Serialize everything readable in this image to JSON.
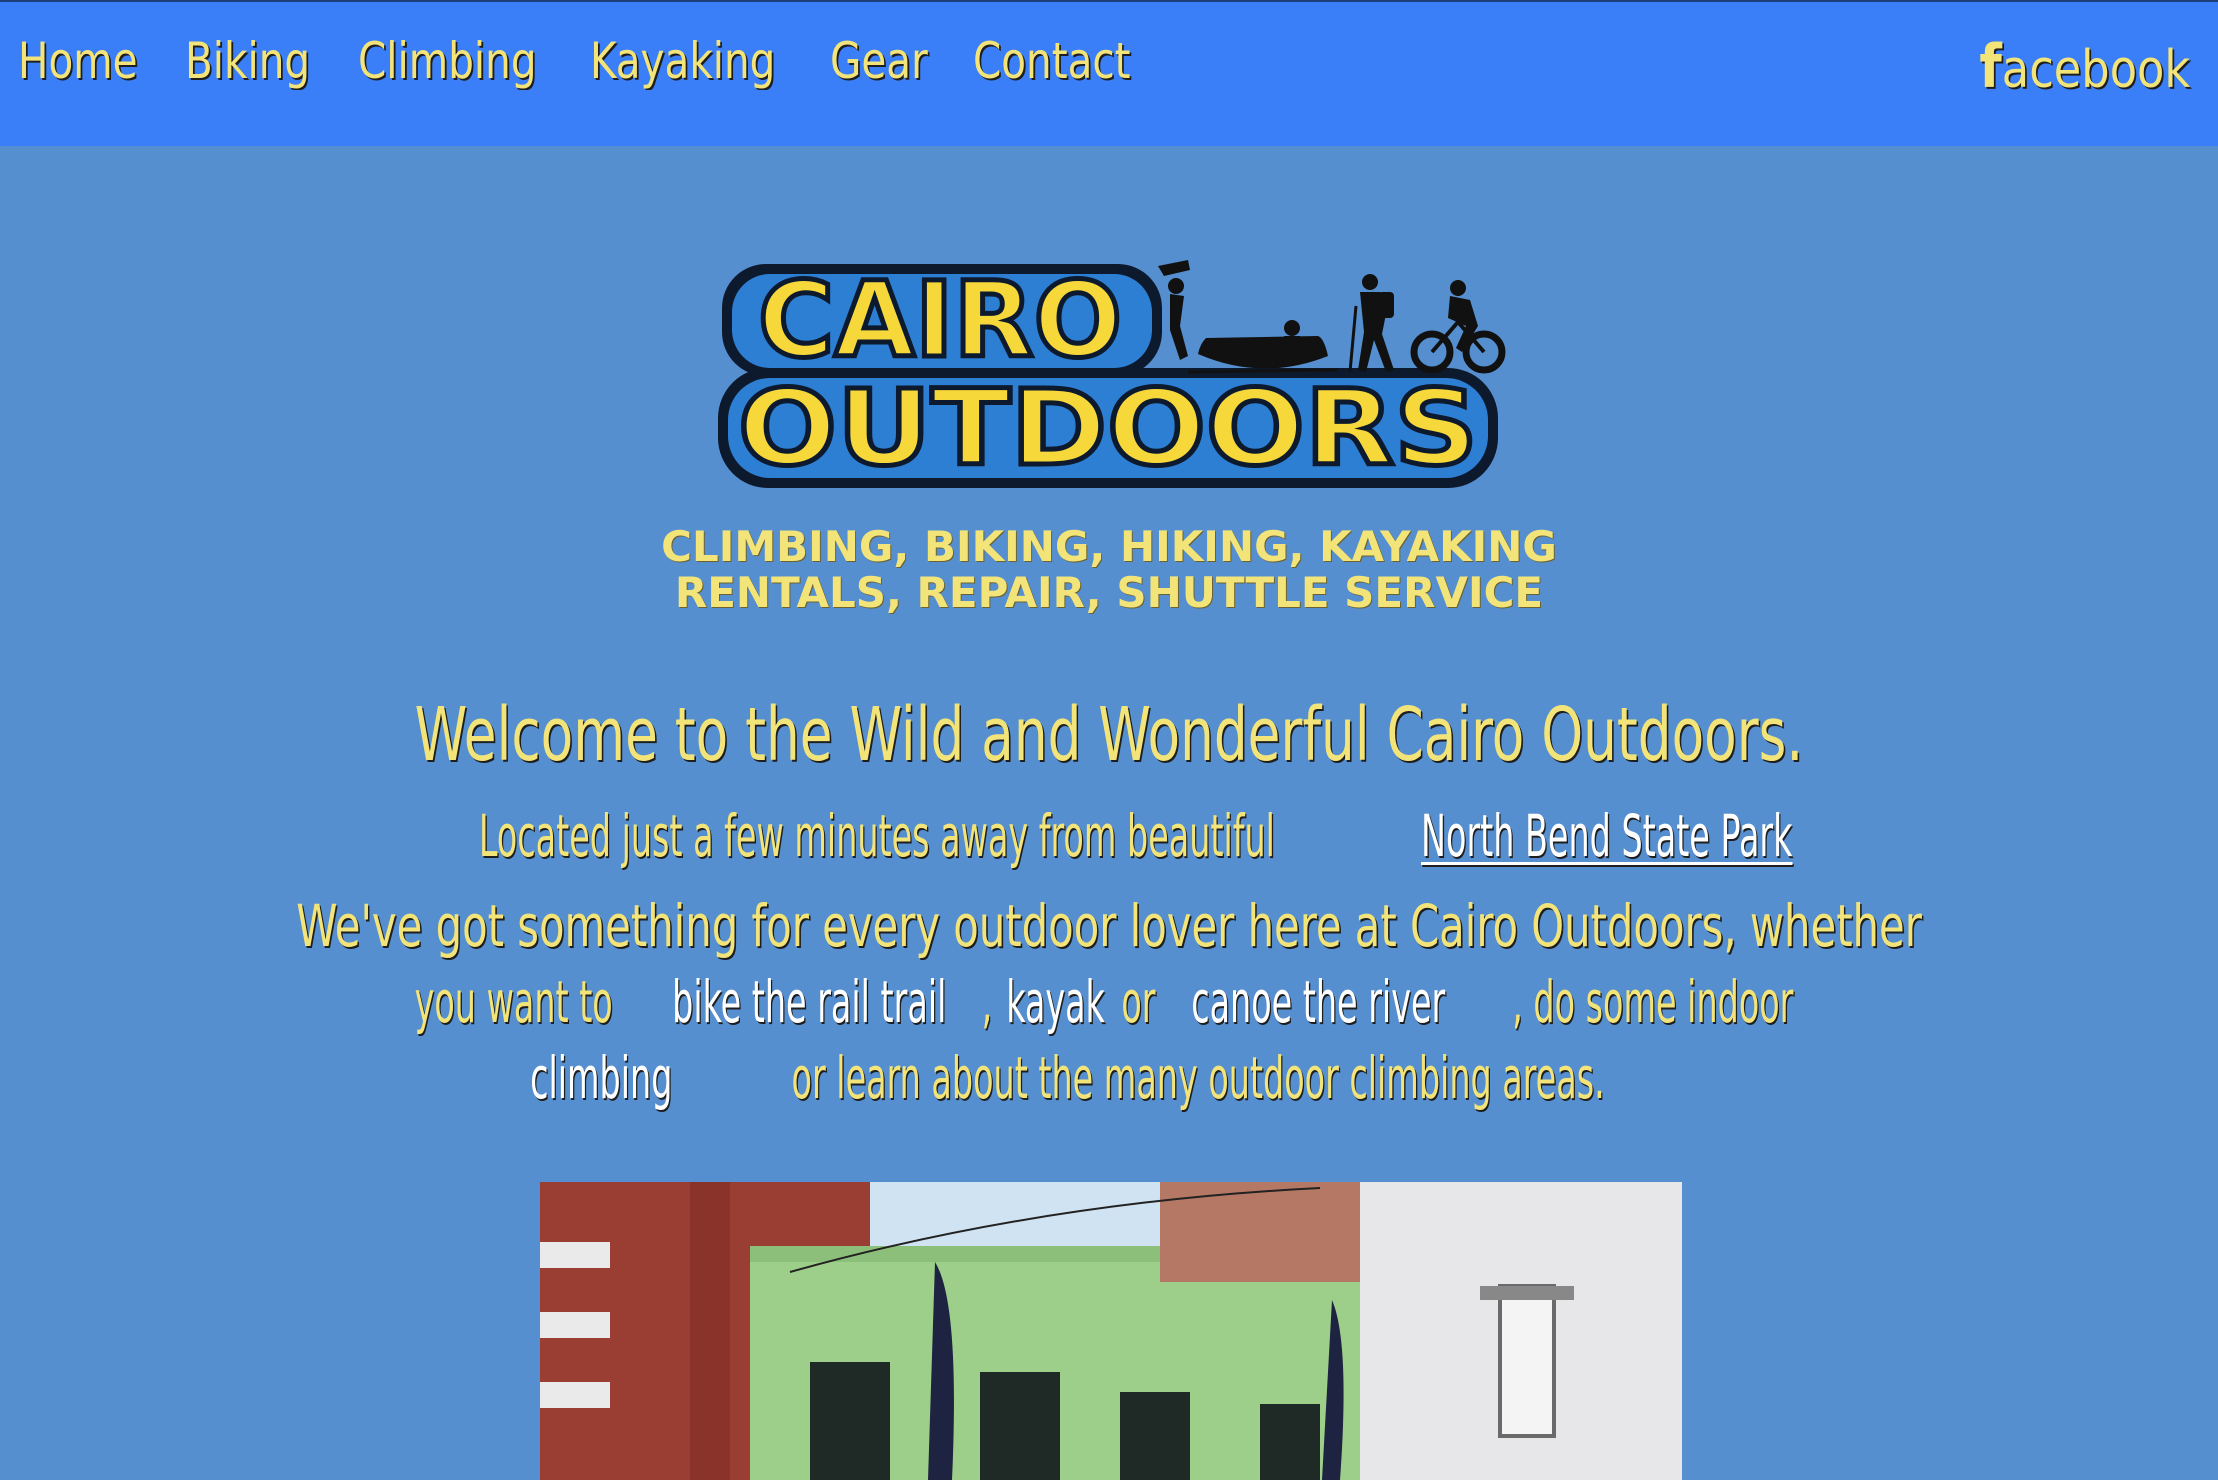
{
  "nav": {
    "links": [
      "Home",
      "Biking",
      "Climbing",
      "Kayaking",
      "Gear",
      "Contact"
    ],
    "facebook_f": "f",
    "facebook_rest": "acebook"
  },
  "logo": {
    "line1": "CAIRO",
    "line2": "OUTDOORS"
  },
  "tagline": {
    "line1": "CLIMBING, BIKING, HIKING, KAYAKING",
    "line2": "RENTALS, REPAIR, SHUTTLE SERVICE"
  },
  "welcome": "Welcome to the Wild and Wonderful Cairo Outdoors.",
  "located": {
    "prefix": "Located just a few minutes away from beautiful ",
    "link": "North Bend State Park"
  },
  "intro": {
    "line1": "We've got something for every outdoor lover here at Cairo Outdoors, whether",
    "line2_a": "you want to ",
    "line2_link1": "bike the rail trail",
    "line2_b": ", ",
    "line2_link2": "kayak",
    "line2_c": " or ",
    "line2_link3": "canoe the river",
    "line2_d": ", do some indoor",
    "line3_link": "climbing",
    "line3_rest": " or learn about the many outdoor climbing areas."
  },
  "colors": {
    "page_bg": "#558fd0",
    "nav_bg": "#3a7ff7",
    "accent_yellow": "#f3e47a"
  }
}
